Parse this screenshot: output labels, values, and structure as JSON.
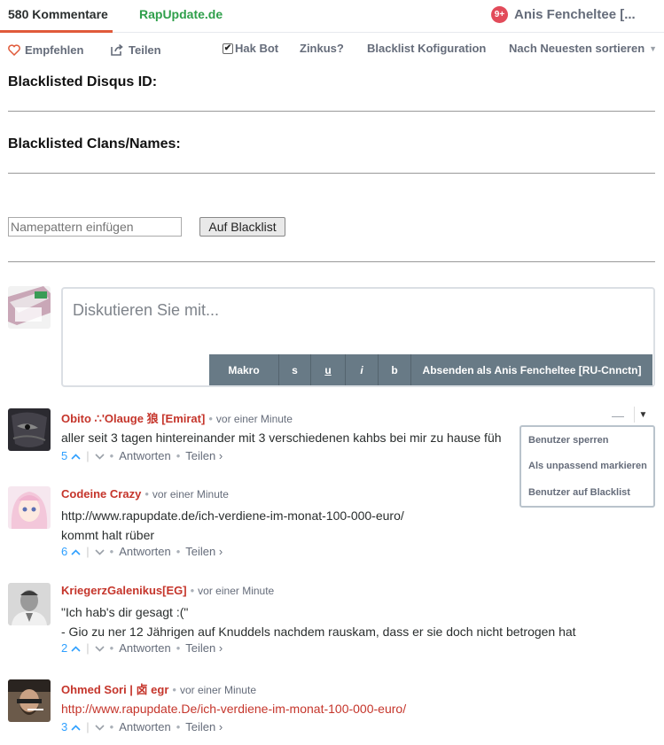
{
  "nav": {
    "comment_count": "580 Kommentare",
    "community": "RapUpdate.de",
    "notifications": "9+",
    "user_name": "Anis Fencheltee [..."
  },
  "actions": {
    "recommend": "Empfehlen",
    "share": "Teilen",
    "hakbot": "Hak Bot",
    "hakbot_checked": true,
    "zinkus": "Zinkus?",
    "blacklist_config": "Blacklist Kofiguration",
    "sort": "Nach Neuesten sortieren"
  },
  "blacklist": {
    "disqus_heading": "Blacklisted Disqus ID:",
    "clans_heading": "Blacklisted Clans/Names:",
    "input_placeholder": "Namepattern einfügen",
    "button": "Auf Blacklist"
  },
  "composer": {
    "placeholder": "Diskutieren Sie mit...",
    "toolbar": {
      "makro": "Makro",
      "s": "s",
      "u": "u",
      "i": "i",
      "b": "b",
      "send": "Absenden als Anis Fencheltee [RU-Cnnctn]"
    }
  },
  "comments": [
    {
      "author": "Obito ∴'Olauge 狼 [Emirat]",
      "time": "vor einer Minute",
      "lines": [
        "aller seit 3 tagen hintereinander mit 3 verschiedenen kahbs bei mir zu hause füh"
      ],
      "votes": "5",
      "reply": "Antworten",
      "share": "Teilen ›"
    },
    {
      "author": "Codeine Crazy",
      "time": "vor einer Minute",
      "lines": [
        "http://www.rapupdate.de/ich-verdiene-im-monat-100-000-euro/",
        "kommt halt rüber"
      ],
      "votes": "6",
      "reply": "Antworten",
      "share": "Teilen ›"
    },
    {
      "author": "KriegerzGalenikus[EG]",
      "time": "vor einer Minute",
      "lines": [
        "\"Ich hab's dir gesagt :(\"",
        "- Gio zu ner 12 Jährigen auf Knuddels nachdem rauskam, dass er sie doch nicht betrogen hat"
      ],
      "votes": "2",
      "reply": "Antworten",
      "share": "Teilen ›"
    },
    {
      "author": "Ohmed Sori | 卤 egr",
      "time": "vor einer Minute",
      "lines": [
        "http://www.rapupdate.De/ich-verdiene-im-monat-100-000-euro/"
      ],
      "votes": "3",
      "reply": "Antworten",
      "share": "Teilen ›"
    }
  ],
  "dropdown": {
    "items": [
      "Benutzer sperren",
      "Als unpassend markieren",
      "Benutzer auf Blacklist"
    ]
  },
  "icons": {
    "heart": "heart-icon",
    "share": "share-icon",
    "upvote": "chevron-up-icon",
    "downvote": "chevron-down-icon",
    "collapse": "minus-icon",
    "menu": "caret-down-icon"
  },
  "colors": {
    "accent": "#e05a3a",
    "author": "#c5352b",
    "community": "#2e9f4a",
    "toolbar": "#687a86",
    "vote": "#2e9fff"
  }
}
